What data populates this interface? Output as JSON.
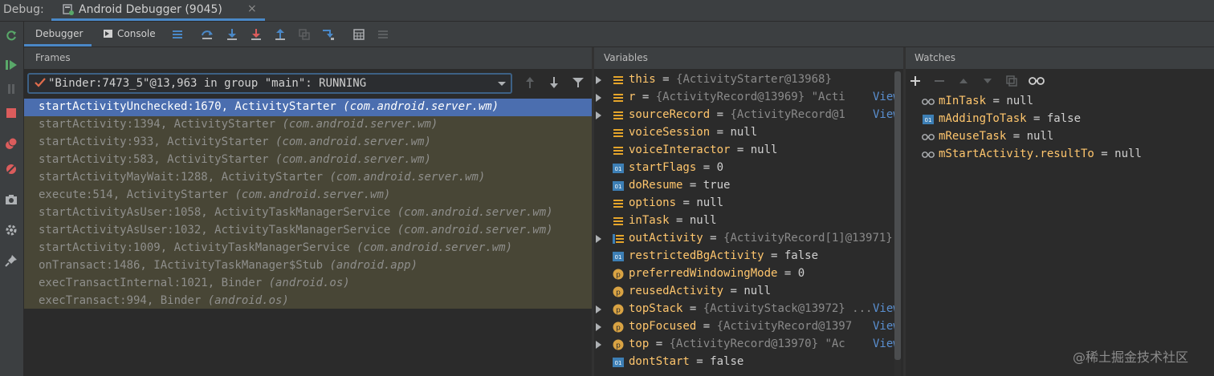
{
  "topbar": {
    "debug_label": "Debug:",
    "tab_title": "Android Debugger (9045)",
    "tab_close": "×"
  },
  "toolbar": {
    "debugger_tab": "Debugger",
    "console_tab": "Console"
  },
  "frames": {
    "header": "Frames",
    "thread": "\"Binder:7473_5\"@13,963 in group \"main\": RUNNING",
    "items": [
      {
        "method": "startActivityUnchecked:1670, ActivityStarter ",
        "pkg": "(com.android.server.wm)"
      },
      {
        "method": "startActivity:1394, ActivityStarter ",
        "pkg": "(com.android.server.wm)"
      },
      {
        "method": "startActivity:933, ActivityStarter ",
        "pkg": "(com.android.server.wm)"
      },
      {
        "method": "startActivity:583, ActivityStarter ",
        "pkg": "(com.android.server.wm)"
      },
      {
        "method": "startActivityMayWait:1288, ActivityStarter ",
        "pkg": "(com.android.server.wm)"
      },
      {
        "method": "execute:514, ActivityStarter ",
        "pkg": "(com.android.server.wm)"
      },
      {
        "method": "startActivityAsUser:1058, ActivityTaskManagerService ",
        "pkg": "(com.android.server.wm)"
      },
      {
        "method": "startActivityAsUser:1032, ActivityTaskManagerService ",
        "pkg": "(com.android.server.wm)"
      },
      {
        "method": "startActivity:1009, ActivityTaskManagerService ",
        "pkg": "(com.android.server.wm)"
      },
      {
        "method": "onTransact:1486, IActivityTaskManager$Stub ",
        "pkg": "(android.app)"
      },
      {
        "method": "execTransactInternal:1021, Binder ",
        "pkg": "(android.os)"
      },
      {
        "method": "execTransact:994, Binder ",
        "pkg": "(android.os)"
      }
    ]
  },
  "variables": {
    "header": "Variables",
    "view_label": "View",
    "items": [
      {
        "name": "this",
        "eq": " = ",
        "value": "{ActivityStarter@13968}"
      },
      {
        "name": "r",
        "eq": " = ",
        "value": "{ActivityRecord@13969} \"Acti"
      },
      {
        "name": "sourceRecord",
        "eq": " = ",
        "value": "{ActivityRecord@1"
      },
      {
        "name": "voiceSession",
        "eq": " = ",
        "value": "null"
      },
      {
        "name": "voiceInteractor",
        "eq": " = ",
        "value": "null"
      },
      {
        "name": "startFlags",
        "eq": " = ",
        "value": "0"
      },
      {
        "name": "doResume",
        "eq": " = ",
        "value": "true"
      },
      {
        "name": "options",
        "eq": " = ",
        "value": "null"
      },
      {
        "name": "inTask",
        "eq": " = ",
        "value": "null"
      },
      {
        "name": "outActivity",
        "eq": " = ",
        "value": "{ActivityRecord[1]@13971}"
      },
      {
        "name": "restrictedBgActivity",
        "eq": " = ",
        "value": "false"
      },
      {
        "name": "preferredWindowingMode",
        "eq": " = ",
        "value": "0"
      },
      {
        "name": "reusedActivity",
        "eq": " = ",
        "value": "null"
      },
      {
        "name": "topStack",
        "eq": " = ",
        "value": "{ActivityStack@13972} ..."
      },
      {
        "name": "topFocused",
        "eq": " = ",
        "value": "{ActivityRecord@1397"
      },
      {
        "name": "top",
        "eq": " = ",
        "value": "{ActivityRecord@13970} \"Ac"
      },
      {
        "name": "dontStart",
        "eq": " = ",
        "value": "false"
      }
    ]
  },
  "watches": {
    "header": "Watches",
    "items": [
      {
        "name": "mInTask",
        "eq": " = ",
        "value": "null"
      },
      {
        "name": "mAddingToTask",
        "eq": " = ",
        "value": "false"
      },
      {
        "name": "mReuseTask",
        "eq": " = ",
        "value": "null"
      },
      {
        "name": "mStartActivity.resultTo",
        "eq": " = ",
        "value": "null"
      }
    ]
  },
  "watermark": "@稀土掘金技术社区",
  "colors": {
    "accent": "#4a88c7",
    "selection": "#4b6eaf",
    "frames_bg": "#484636",
    "var_name": "#ffc66d"
  }
}
